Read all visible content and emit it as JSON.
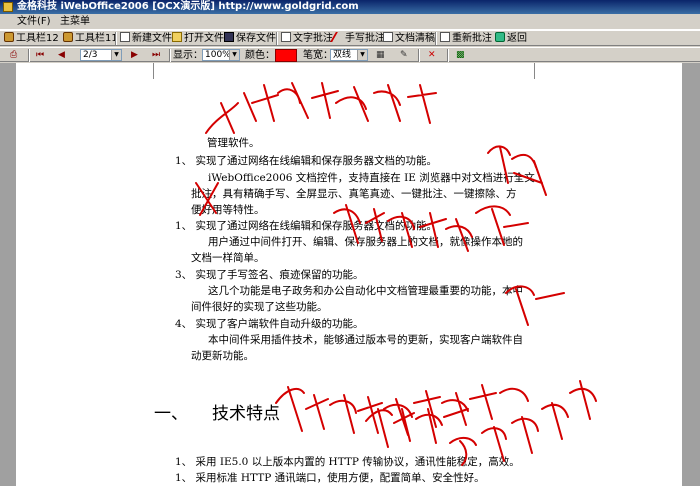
{
  "window": {
    "title": "金格科技 iWebOffice2006 [OCX演示版] http://www.goldgrid.com"
  },
  "menu": {
    "items": [
      "文件(F)",
      "主菜单"
    ]
  },
  "toolbar1": {
    "buttons": [
      "工具栏12",
      "工具栏11",
      "新建文件",
      "打开文件",
      "保存文件",
      "文字批注",
      "手写批注",
      "文档清稿",
      "重新批注",
      "返回"
    ]
  },
  "toolbar2": {
    "page_value": "2/3",
    "display_label": "显示：",
    "zoom_value": "100%",
    "color_label": "颜色：",
    "brush_label": "笔宽：",
    "brush_value": "双线",
    "pen_color": "#ff0000"
  },
  "document": {
    "lines": [
      "管理软件。",
      "1、 实现了通过网络在线编辑和保存服务器文档的功能。",
      "iWebOffice2006 文档控件，支持直接在 IE 浏览器中对文档进行全文",
      "批注，具有精确手写、全屏显示、真笔真迹、一键批注、一键擦除、方",
      "便好用等特性。",
      "1、 实现了通过网络在线编辑和保存服务器文档的功能。",
      "用户通过中间件打开、编辑、保存服务器上的文档，就像操作本地的",
      "文档一样简单。",
      "3、 实现了手写签名、痕迹保留的功能。",
      "这几个功能是电子政务和办公自动化中文档管理最重要的功能，本中",
      "间件很好的实现了这些功能。",
      "4、 实现了客户端软件自动升级的功能。",
      "本中间件采用插件技术，能够通过版本号的更新，实现客户端软件自",
      "动更新功能。",
      "1、 采用 IE5.0 以上版本内置的 HTTP 传输协议，通讯性能稳定，高效。",
      "1、 采用标准 HTTP 通讯端口，使用方便，配置简单、安全性好。"
    ],
    "heading_number": "一、",
    "heading_text": "技术特点"
  }
}
